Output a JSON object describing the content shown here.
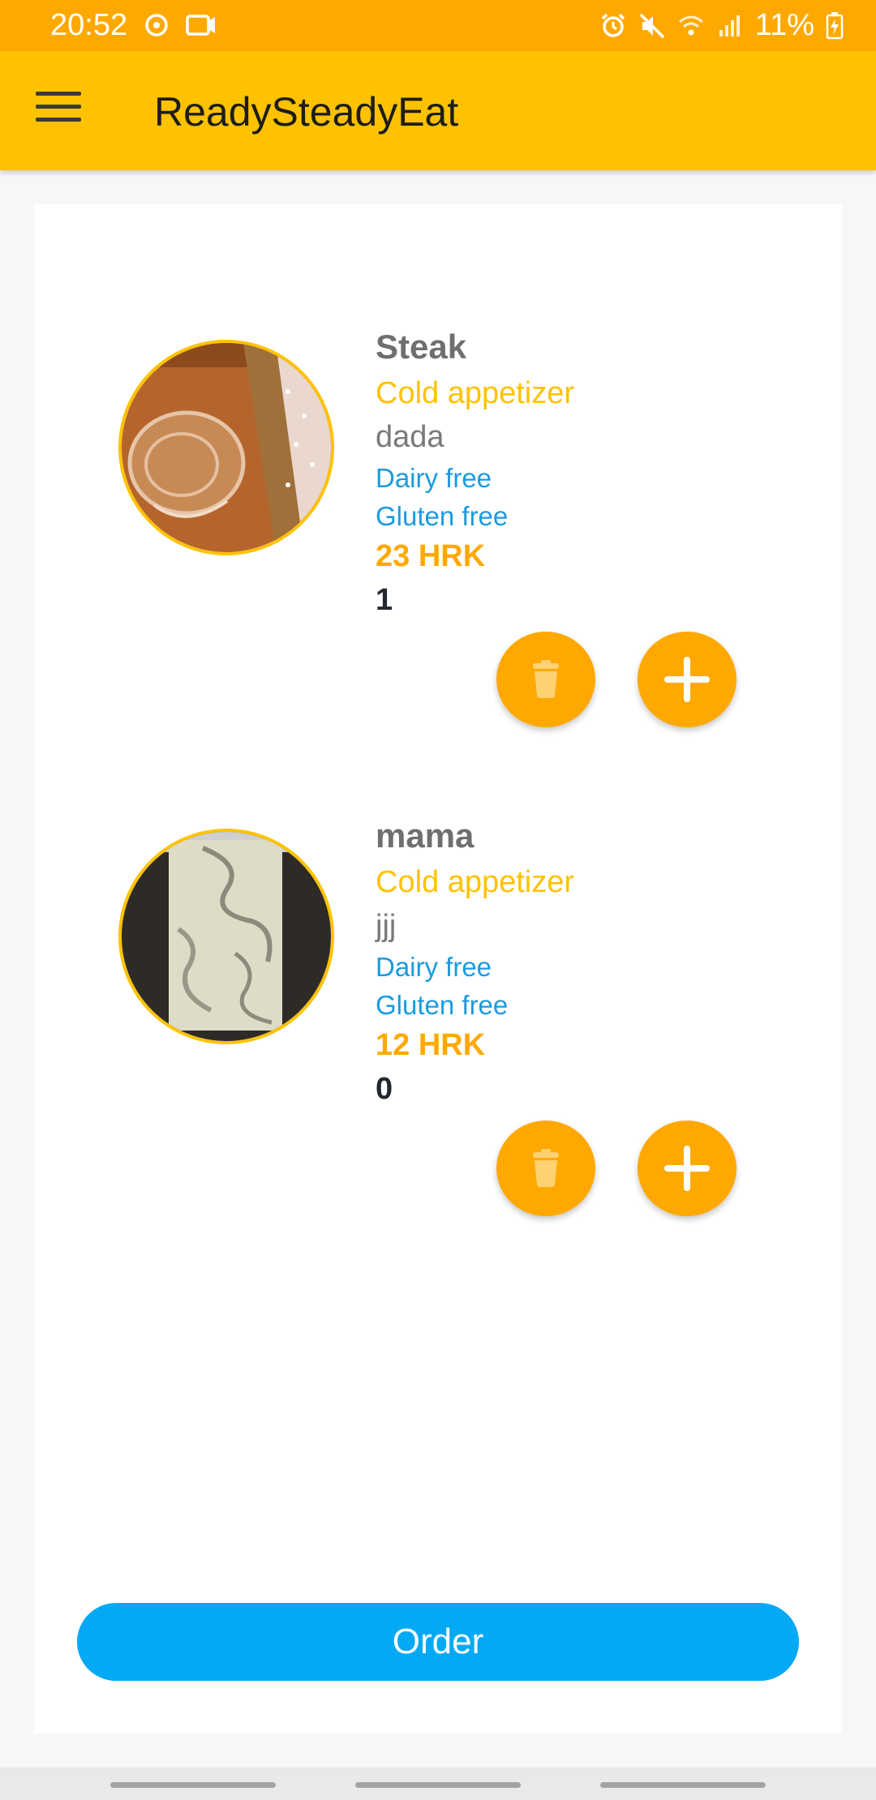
{
  "status_bar": {
    "time": "20:52",
    "battery": "11%",
    "left_icons": [
      "sync-icon",
      "camera-notification-icon"
    ],
    "right_icons": [
      "alarm-icon",
      "mute-icon",
      "wifi-icon",
      "signal-icon",
      "battery-charging-icon"
    ]
  },
  "app_bar": {
    "title": "ReadySteadyEat",
    "menu_icon": "hamburger-menu-icon"
  },
  "items": [
    {
      "name": "Steak",
      "category": "Cold appetizer",
      "description": "dada",
      "tags": [
        "Dairy free",
        "Gluten free"
      ],
      "price": "23 HRK",
      "quantity": "1"
    },
    {
      "name": "mama",
      "category": "Cold appetizer",
      "description": "jjj",
      "tags": [
        "Dairy free",
        "Gluten free"
      ],
      "price": "12 HRK",
      "quantity": "0"
    }
  ],
  "order_button": "Order",
  "colors": {
    "status_bar": "#ffa900",
    "app_bar": "#ffc200",
    "accent": "#ffa900",
    "category": "#ffc200",
    "tag": "#1a9be0",
    "order_button": "#03a9f4"
  }
}
